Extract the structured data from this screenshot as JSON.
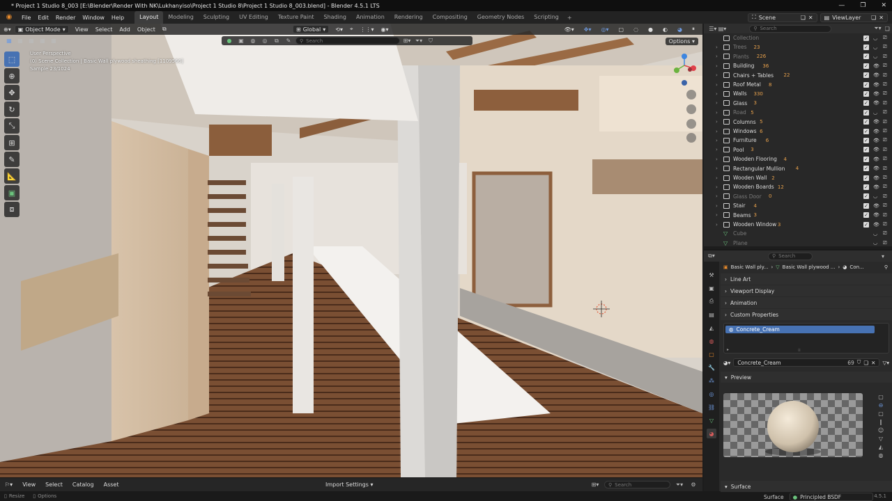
{
  "window": {
    "title": "* Project 1 Studio 8_003 [E:\\Blender\\Render With NK\\Lukhanyiso\\Project 1 Studio 8\\Project 1 Studio 8_003.blend] - Blender 4.5.1 LTS",
    "minimize": "—",
    "maximize": "❐",
    "close": "✕"
  },
  "menu": {
    "items": [
      "File",
      "Edit",
      "Render",
      "Window",
      "Help"
    ],
    "workspaces": [
      "Layout",
      "Modeling",
      "Sculpting",
      "UV Editing",
      "Texture Paint",
      "Shading",
      "Animation",
      "Rendering",
      "Compositing",
      "Geometry Nodes",
      "Scripting"
    ],
    "active_workspace": "Layout",
    "scene": "Scene",
    "view_layer": "ViewLayer"
  },
  "viewport": {
    "mode": "Object Mode",
    "menus": [
      "View",
      "Select",
      "Add",
      "Object"
    ],
    "transform": "Global",
    "search_placeholder": "Search",
    "options": "Options",
    "overlay_lines": [
      "User Perspective",
      "(0) Scene Collection | Basic Wall plywood sheathing [1109566]",
      "Sample 23/1024"
    ]
  },
  "bottom": {
    "items": [
      "View",
      "Select",
      "Catalog",
      "Asset"
    ],
    "import_settings": "Import Settings",
    "search_placeholder": "Search"
  },
  "status": {
    "left": [
      "Resize",
      "Options"
    ],
    "version": "4.5.1"
  },
  "outliner": {
    "search_placeholder": "Search",
    "rows": [
      {
        "name": "Collection",
        "dim": true,
        "count": ""
      },
      {
        "name": "Trees",
        "dim": true,
        "count": "23"
      },
      {
        "name": "Plants",
        "dim": true,
        "count": "226"
      },
      {
        "name": "Building",
        "dim": false,
        "count": "36"
      },
      {
        "name": "Chairs + Tables",
        "dim": false,
        "count": "22"
      },
      {
        "name": "Roof Metal",
        "dim": false,
        "count": "8"
      },
      {
        "name": "Walls",
        "dim": false,
        "count": "330"
      },
      {
        "name": "Glass",
        "dim": false,
        "count": "3"
      },
      {
        "name": "Road",
        "dim": true,
        "count": "5"
      },
      {
        "name": "Columns",
        "dim": false,
        "count": "5"
      },
      {
        "name": "Windows",
        "dim": false,
        "count": "6"
      },
      {
        "name": "Furniture",
        "dim": false,
        "count": "6"
      },
      {
        "name": "Pool",
        "dim": false,
        "count": "3"
      },
      {
        "name": "Wooden Flooring",
        "dim": false,
        "count": "4"
      },
      {
        "name": "Rectangular Mullion",
        "dim": false,
        "count": "4"
      },
      {
        "name": "Wooden Wall",
        "dim": false,
        "count": "2"
      },
      {
        "name": "Wooden Boards",
        "dim": false,
        "count": "12"
      },
      {
        "name": "Glass Door",
        "dim": true,
        "count": "0"
      },
      {
        "name": "Stair",
        "dim": false,
        "count": "4"
      },
      {
        "name": "Beams",
        "dim": false,
        "count": "3"
      },
      {
        "name": "Wooden Window",
        "dim": false,
        "count": "3"
      },
      {
        "name": "Cube",
        "dim": true,
        "count": ""
      },
      {
        "name": "Plane",
        "dim": true,
        "count": ""
      }
    ]
  },
  "properties": {
    "search_placeholder": "Search",
    "breadcrumb": [
      "Basic Wall ply...",
      "Basic Wall plywood ...",
      "Con..."
    ],
    "panels": [
      "Line Art",
      "Viewport Display",
      "Animation",
      "Custom Properties"
    ],
    "material_slot": "Concrete_Cream",
    "material_name": "Concrete_Cream",
    "users": "69",
    "preview_label": "Preview",
    "surface_panel": "Surface",
    "surface_label": "Surface",
    "surface_shader": "Principled BSDF"
  }
}
